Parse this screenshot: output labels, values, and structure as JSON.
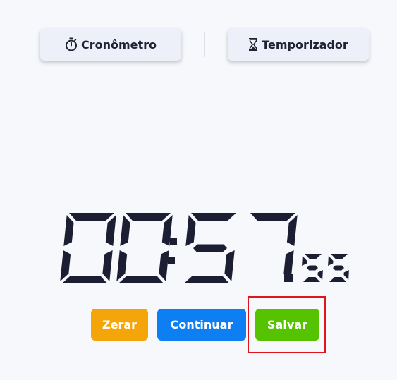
{
  "tabs": {
    "stopwatch": {
      "label": "Cronômetro",
      "icon": "stopwatch-icon"
    },
    "timer": {
      "label": "Temporizador",
      "icon": "hourglass-icon"
    }
  },
  "display": {
    "minutes": "00",
    "separator": ":",
    "seconds": "57",
    "fraction": ".55",
    "color": "#1c1f33"
  },
  "controls": {
    "reset_label": "Zerar",
    "continue_label": "Continuar",
    "save_label": "Salvar"
  },
  "colors": {
    "background": "#f7f8fc",
    "reset": "#f4a509",
    "continue": "#0d7ff3",
    "save": "#56c300",
    "highlight": "#e1141c"
  }
}
